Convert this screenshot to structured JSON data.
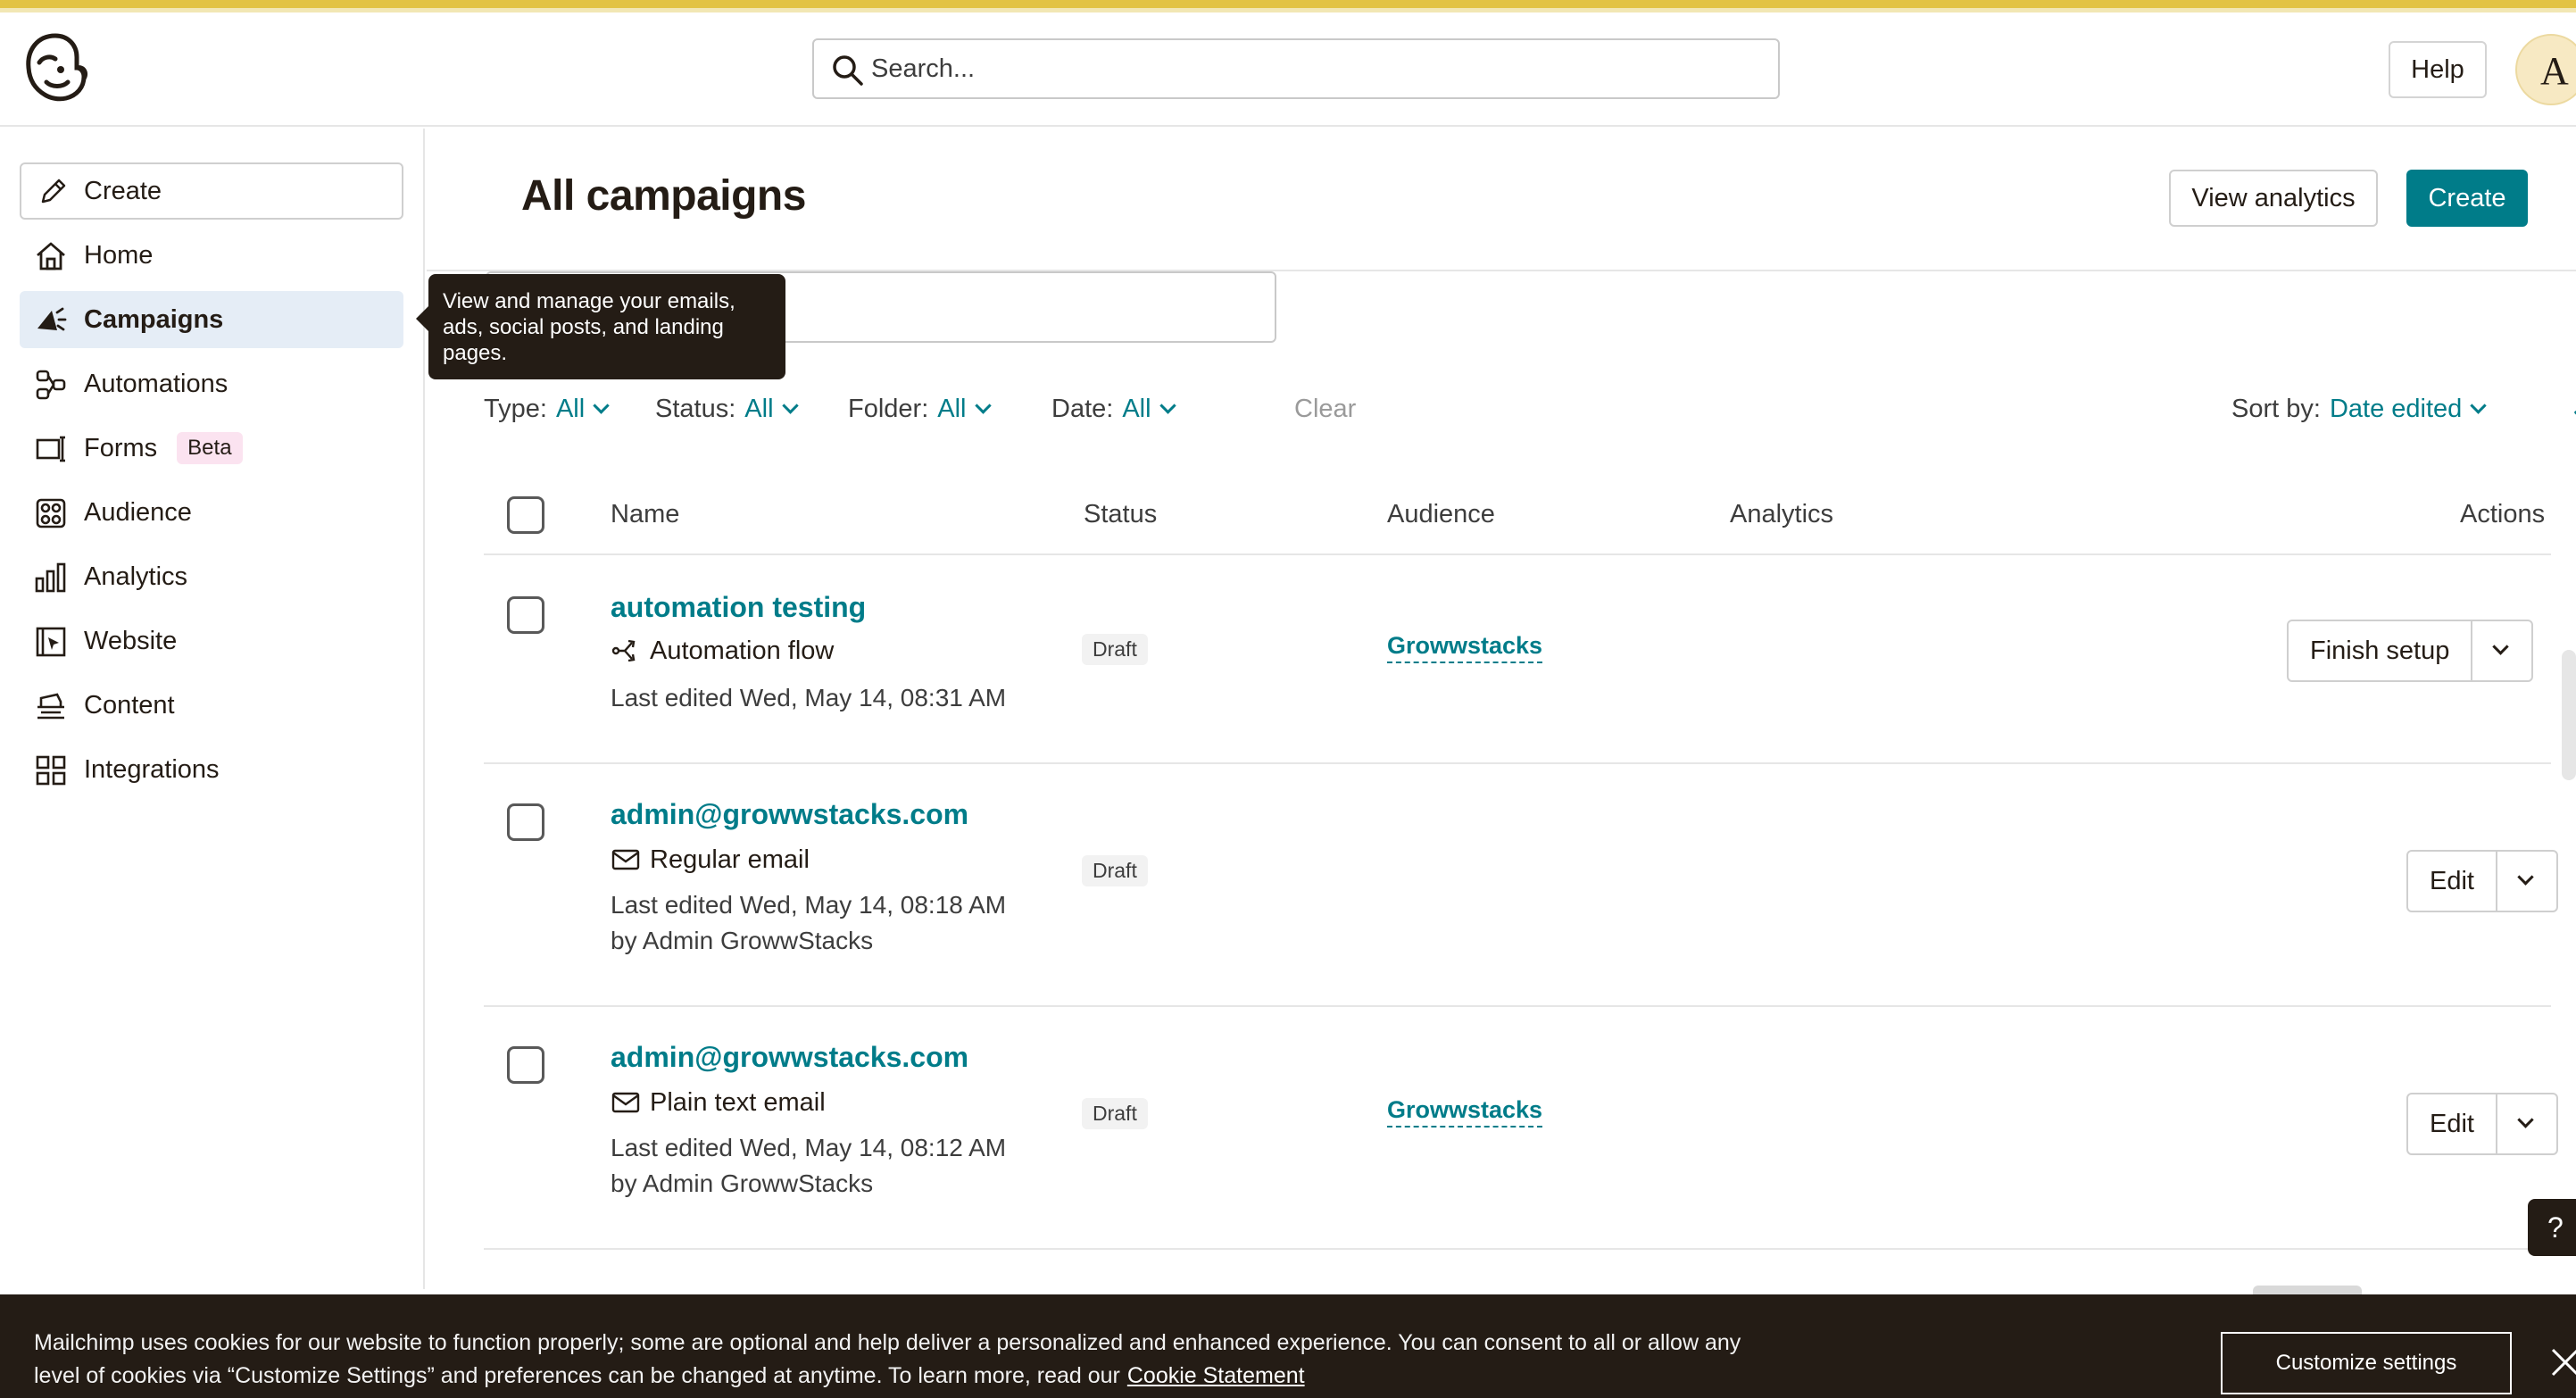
{
  "header": {
    "search_placeholder": "Search...",
    "help_label": "Help",
    "avatar_initial": "A"
  },
  "sidebar": {
    "create_label": "Create",
    "items": [
      {
        "label": "Home",
        "icon": "home-icon"
      },
      {
        "label": "Campaigns",
        "icon": "megaphone-icon",
        "active": true
      },
      {
        "label": "Automations",
        "icon": "automation-icon"
      },
      {
        "label": "Forms",
        "icon": "forms-icon",
        "badge": "Beta"
      },
      {
        "label": "Audience",
        "icon": "audience-icon"
      },
      {
        "label": "Analytics",
        "icon": "bar-chart-icon"
      },
      {
        "label": "Website",
        "icon": "website-icon"
      },
      {
        "label": "Content",
        "icon": "content-icon"
      },
      {
        "label": "Integrations",
        "icon": "integrations-icon"
      }
    ]
  },
  "tooltip": {
    "text": "View and manage your emails, ads, social posts, and landing pages."
  },
  "page": {
    "title": "All campaigns",
    "view_analytics_label": "View analytics",
    "create_label": "Create"
  },
  "filters": {
    "type_label": "Type:",
    "type_value": "All",
    "status_label": "Status:",
    "status_value": "All",
    "folder_label": "Folder:",
    "folder_value": "All",
    "date_label": "Date:",
    "date_value": "All",
    "clear_label": "Clear",
    "sort_label": "Sort by:",
    "sort_value": "Date edited"
  },
  "table": {
    "columns": [
      "Name",
      "Status",
      "Audience",
      "Analytics",
      "Actions"
    ],
    "rows": [
      {
        "name": "automation testing",
        "type": "Automation flow",
        "meta1": "Last edited Wed, May 14, 08:31 AM",
        "meta2": "",
        "status": "Draft",
        "audience": "Growwstacks",
        "action": "Finish setup"
      },
      {
        "name": "admin@growwstacks.com",
        "type": "Regular email",
        "meta1": "Last edited Wed, May 14, 08:18 AM",
        "meta2": "by Admin GrowwStacks",
        "status": "Draft",
        "audience": "",
        "action": "Edit"
      },
      {
        "name": "admin@growwstacks.com",
        "type": "Plain text email",
        "meta1": "Last edited Wed, May 14, 08:12 AM",
        "meta2": "by Admin GrowwStacks",
        "status": "Draft",
        "audience": "Growwstacks",
        "action": "Edit"
      }
    ]
  },
  "help_float": "?",
  "cookie": {
    "text": "Mailchimp uses cookies for our website to function properly; some are optional and help deliver a personalized and enhanced experience. You can consent to all or allow any level of cookies via “Customize Settings” and preferences can be changed at anytime. To learn more, read our",
    "link": "Cookie Statement",
    "button": "Customize settings"
  },
  "colors": {
    "accent": "#007c89",
    "dark": "#241c15",
    "active_nav": "#e5edf6",
    "brand_stripe": "#e2c344"
  }
}
